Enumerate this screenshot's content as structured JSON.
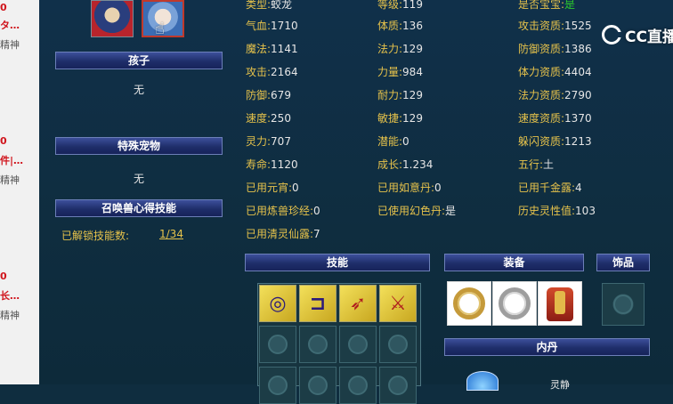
{
  "left_strip": [
    {
      "text": "0",
      "style": "red"
    },
    {
      "text": "タ…",
      "style": "red"
    },
    {
      "text": "精神",
      "style": "gray"
    },
    {
      "text": "0",
      "style": "red"
    },
    {
      "text": "件|…",
      "style": "red"
    },
    {
      "text": "精神",
      "style": "gray"
    },
    {
      "text": "0",
      "style": "red"
    },
    {
      "text": "长…",
      "style": "red"
    },
    {
      "text": "精神",
      "style": "gray"
    }
  ],
  "sections": {
    "children_title": "孩子",
    "children_value": "无",
    "special_pet_title": "特殊宠物",
    "special_pet_value": "无",
    "summon_skill_title": "召唤兽心得技能",
    "unlocked_label": "已解锁技能数:",
    "unlocked_value": "1/34"
  },
  "stats": {
    "col1": [
      {
        "k": "类型:",
        "v": "蛟龙"
      },
      {
        "k": "气血:",
        "v": "1710"
      },
      {
        "k": "魔法:",
        "v": "1141"
      },
      {
        "k": "攻击:",
        "v": "2164"
      },
      {
        "k": "防御:",
        "v": "679"
      },
      {
        "k": "速度:",
        "v": "250"
      },
      {
        "k": "灵力:",
        "v": "707"
      },
      {
        "k": "寿命:",
        "v": "1120"
      },
      {
        "k": "已用元宵:",
        "v": "0"
      },
      {
        "k": "已用炼兽珍经:",
        "v": "0"
      },
      {
        "k": "已用清灵仙露:",
        "v": "7"
      }
    ],
    "col2": [
      {
        "k": "等级:",
        "v": "119"
      },
      {
        "k": "体质:",
        "v": "136"
      },
      {
        "k": "法力:",
        "v": "129"
      },
      {
        "k": "力量:",
        "v": "984"
      },
      {
        "k": "耐力:",
        "v": "129"
      },
      {
        "k": "敏捷:",
        "v": "129"
      },
      {
        "k": "潜能:",
        "v": "0"
      },
      {
        "k": "成长:",
        "v": "1.234"
      },
      {
        "k": "已用如意丹:",
        "v": "0"
      },
      {
        "k": "已使用幻色丹:",
        "v": "是"
      }
    ],
    "col3": [
      {
        "k": "是否宝宝:",
        "v": "是",
        "green": true
      },
      {
        "k": "攻击资质:",
        "v": "1525"
      },
      {
        "k": "防御资质:",
        "v": "1386"
      },
      {
        "k": "体力资质:",
        "v": "4404"
      },
      {
        "k": "法力资质:",
        "v": "2790"
      },
      {
        "k": "速度资质:",
        "v": "1370"
      },
      {
        "k": "躲闪资质:",
        "v": "1213"
      },
      {
        "k": "五行:",
        "v": "土"
      },
      {
        "k": "已用千金露:",
        "v": "4"
      },
      {
        "k": "历史灵性值:",
        "v": "103"
      }
    ]
  },
  "panels": {
    "skills_title": "技能",
    "equipment_title": "装备",
    "accessory_title": "饰品",
    "neidan_title": "内丹"
  },
  "skill_icons": [
    "swirl-skill-icon",
    "shield-skill-icon",
    "bow-skill-icon",
    "sword-skill-icon"
  ],
  "equipment_icons": [
    "gold-ring-icon",
    "silver-ring-icon",
    "armor-icon"
  ],
  "neidan_partial_text": "灵静",
  "logo": {
    "text": "CC直播"
  },
  "colors": {
    "label": "#e6c24b",
    "value": "#e6e6e6",
    "green": "#2ccb2c",
    "bar": "#1f2e6a",
    "background": "#0f2d3f"
  }
}
